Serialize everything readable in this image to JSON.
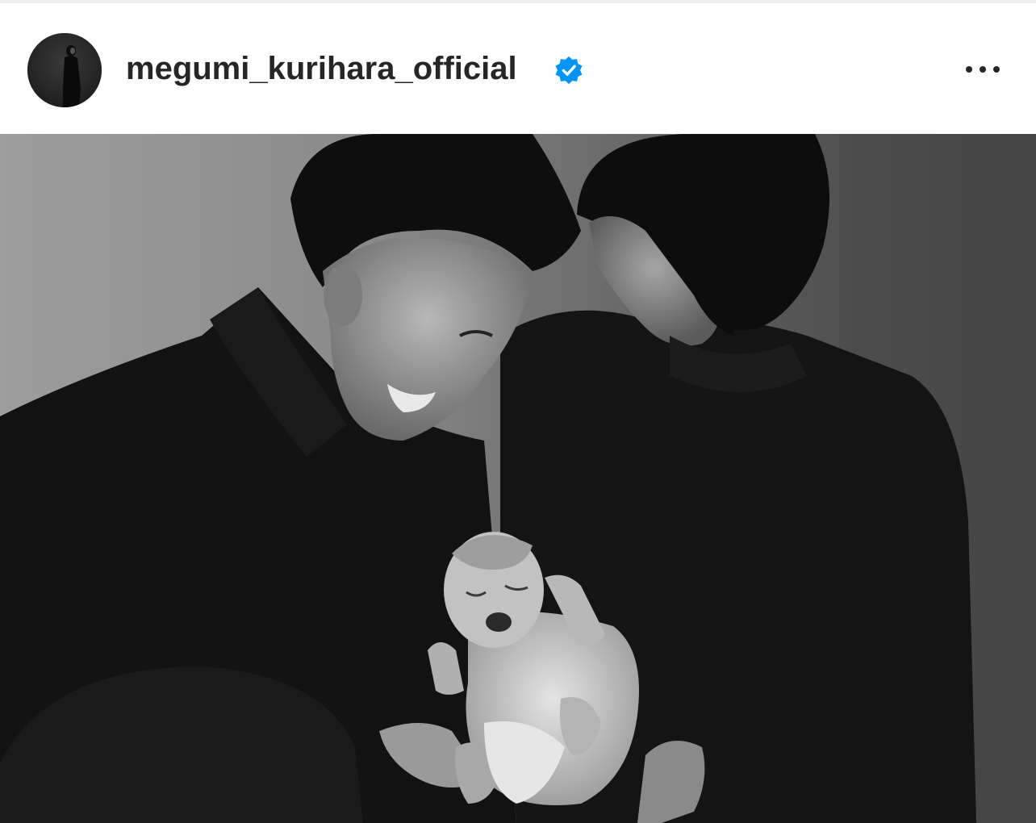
{
  "post": {
    "header": {
      "username": "megumi_kurihara_official",
      "verified": true,
      "avatar_icon": "profile-avatar",
      "more_icon": "more-horizontal-icon"
    },
    "image": {
      "alt_icon": "photo"
    }
  },
  "colors": {
    "text": "#262626",
    "verified_blue": "#0095f6",
    "background": "#ffffff"
  }
}
